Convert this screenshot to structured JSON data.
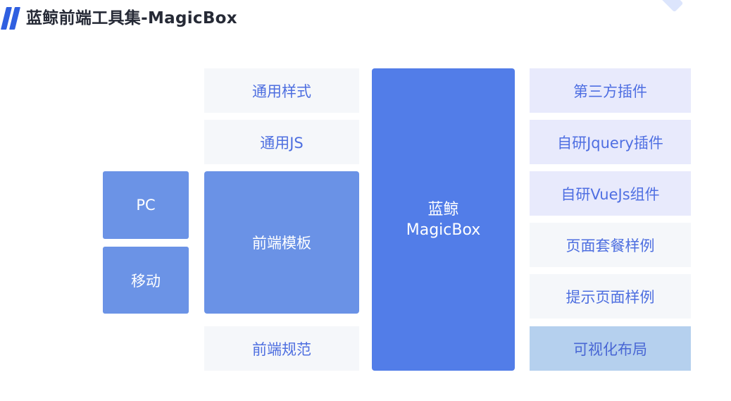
{
  "header": {
    "title": "蓝鲸前端工具集-MagicBox",
    "logo_icon": "slanted-bars-icon"
  },
  "colors": {
    "accent": "#2f5fe0",
    "center_box": "#527de8",
    "template_box": "#6a92e6",
    "light_box": "#f5f7fa",
    "lavender_box": "#e8eafc",
    "sky_box": "#b5d0ee"
  },
  "platforms": {
    "pc": "PC",
    "mobile": "移动"
  },
  "basics": {
    "common_styles": "通用样式",
    "common_js": "通用JS",
    "frontend_templates": "前端模板",
    "frontend_standards": "前端规范"
  },
  "center": {
    "line1": "蓝鲸",
    "line2": "MagicBox"
  },
  "features": {
    "third_party_plugins": "第三方插件",
    "jquery_plugins": "自研Jquery插件",
    "vuejs_components": "自研VueJs组件",
    "page_package_examples": "页面套餐样例",
    "prompt_page_examples": "提示页面样例",
    "visual_layout": "可视化布局"
  }
}
